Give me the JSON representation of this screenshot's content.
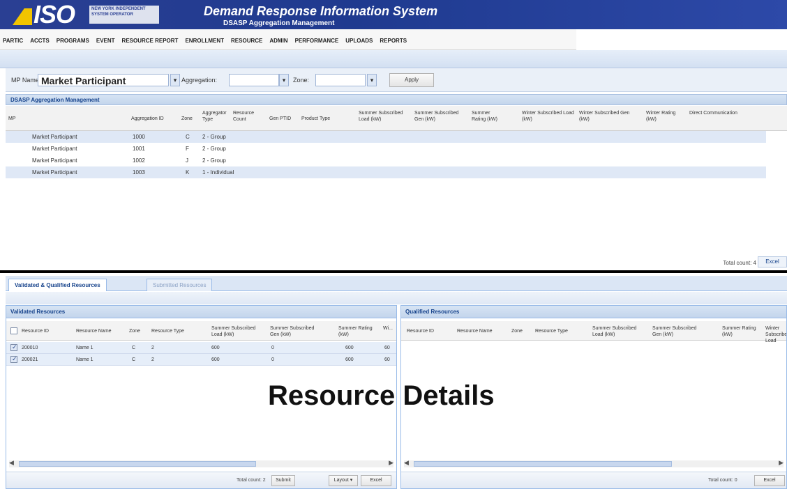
{
  "header": {
    "logo_text": "ISO",
    "logo_sub": "NEW YORK INDEPENDENT SYSTEM OPERATOR",
    "title": "Demand Response Information System",
    "subtitle": "DSASP Aggregation Management"
  },
  "menu": {
    "items": [
      "PARTIC",
      "ACCTS",
      "PROGRAMS",
      "EVENT",
      "RESOURCE REPORT",
      "ENROLLMENT",
      "RESOURCE",
      "ADMIN",
      "PERFORMANCE",
      "UPLOADS",
      "REPORTS"
    ]
  },
  "filter": {
    "mp_label": "MP Name:",
    "mp_value": "Market Participant",
    "aggregation_label": "Aggregation:",
    "zone_label": "Zone:",
    "apply_label": "Apply"
  },
  "aggregation_panel": {
    "title": "DSASP Aggregation Management",
    "columns": [
      "MP",
      "Aggregation ID",
      "Zone",
      "Aggregator Type",
      "Resource Count",
      "Gen PTID",
      "Product Type",
      "Summer Subscribed Load (kW)",
      "Summer Subscribed Gen (kW)",
      "Summer Rating (kW)",
      "Winter Subscribed Load (kW)",
      "Winter Subscribed Gen (kW)",
      "Winter Rating (kW)",
      "Direct Communication"
    ],
    "rows": [
      {
        "mp": "Market Participant",
        "agg_id": "1000",
        "zone": "C",
        "type": "2 - Group"
      },
      {
        "mp": "Market Participant",
        "agg_id": "1001",
        "zone": "F",
        "type": "2 - Group"
      },
      {
        "mp": "Market Participant",
        "agg_id": "1002",
        "zone": "J",
        "type": "2 - Group"
      },
      {
        "mp": "Market Participant",
        "agg_id": "1003",
        "zone": "K",
        "type": "1 - Individual"
      }
    ],
    "total_count": "Total count: 4",
    "excel_label": "Excel"
  },
  "tabs": {
    "active": "Validated & Qualified Resources",
    "inactive": "Submitted Resources"
  },
  "validated": {
    "title": "Validated Resources",
    "columns": [
      "Resource ID",
      "Resource Name",
      "Zone",
      "Resource Type",
      "Summer Subscribed Load (kW)",
      "Summer Subscribed Gen (kW)",
      "Summer Rating (kW)",
      "Wi..."
    ],
    "rows": [
      {
        "id": "200010",
        "name": "Name 1",
        "zone": "C",
        "type": "2",
        "load": "600",
        "gen": "0",
        "rating": "600",
        "extra": "60"
      },
      {
        "id": "200021",
        "name": "Name 1",
        "zone": "C",
        "type": "2",
        "load": "600",
        "gen": "0",
        "rating": "600",
        "extra": "60"
      }
    ],
    "footer_count": "Total count: 2",
    "submit_label": "Submit",
    "layout_label": "Layout ▾",
    "excel_label": "Excel"
  },
  "qualified": {
    "title": "Qualified Resources",
    "columns": [
      "Resource ID",
      "Resource Name",
      "Zone",
      "Resource Type",
      "Summer Subscribed Load (kW)",
      "Summer Subscribed Gen (kW)",
      "Summer Rating (kW)",
      "Winter Subscribed Load"
    ],
    "footer_count": "Total count: 0",
    "excel_label": "Excel"
  },
  "overlay": {
    "text": "Resource Details"
  }
}
